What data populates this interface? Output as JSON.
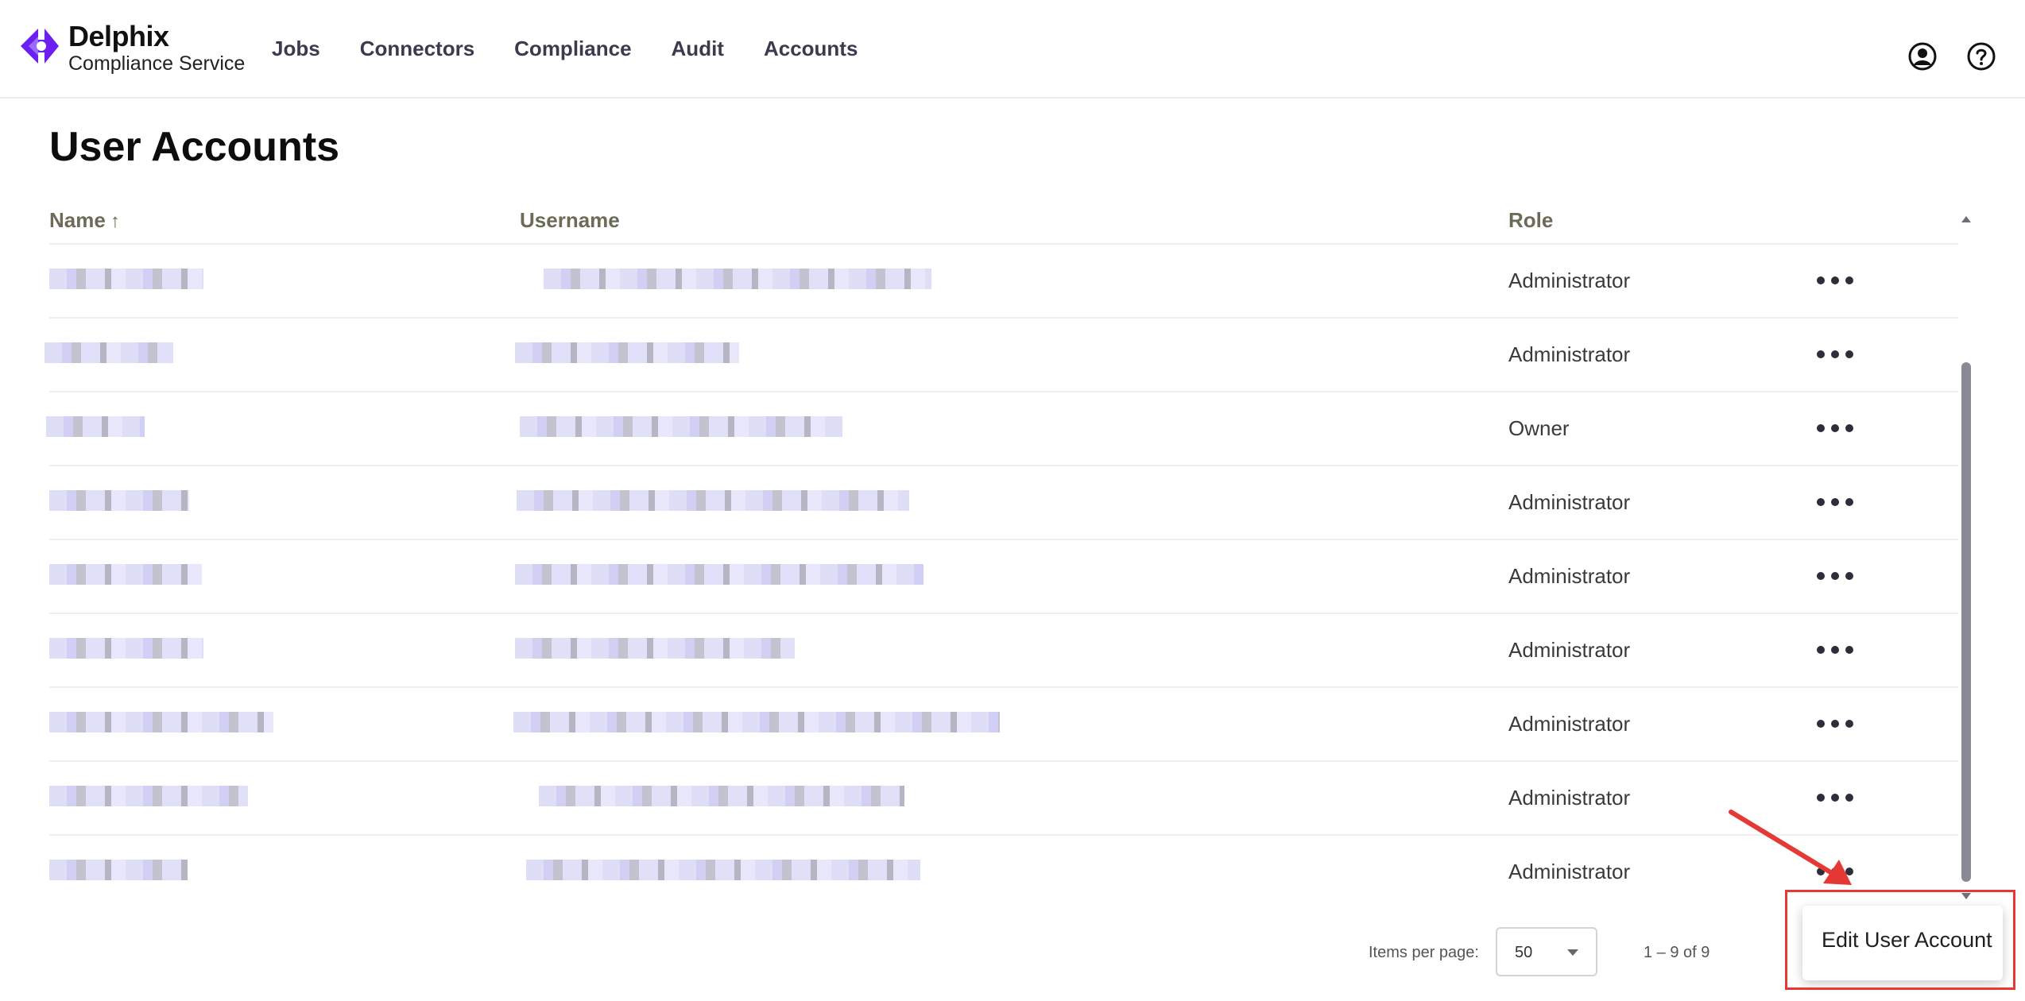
{
  "app": {
    "brand_title": "Delphix",
    "brand_subtitle": "Compliance Service",
    "accent_color": "#6b1ff1"
  },
  "nav": {
    "items": [
      {
        "label": "Jobs"
      },
      {
        "label": "Connectors"
      },
      {
        "label": "Compliance"
      },
      {
        "label": "Audit"
      },
      {
        "label": "Accounts"
      }
    ]
  },
  "header_icons": {
    "account": "user-circle-icon",
    "help": "help-circle-icon"
  },
  "page": {
    "title": "User Accounts"
  },
  "table": {
    "columns": {
      "name": "Name",
      "username": "Username",
      "role": "Role"
    },
    "sort_indicator": "↑",
    "rows": [
      {
        "role": "Administrator"
      },
      {
        "role": "Administrator"
      },
      {
        "role": "Owner"
      },
      {
        "role": "Administrator"
      },
      {
        "role": "Administrator"
      },
      {
        "role": "Administrator"
      },
      {
        "role": "Administrator"
      },
      {
        "role": "Administrator"
      },
      {
        "role": "Administrator"
      }
    ]
  },
  "paginator": {
    "items_per_page_label": "Items per page:",
    "page_size": "50",
    "range_label": "1 – 9 of 9"
  },
  "row_menu": {
    "edit_label": "Edit User Account"
  },
  "annotation": {
    "color": "#e53935"
  }
}
